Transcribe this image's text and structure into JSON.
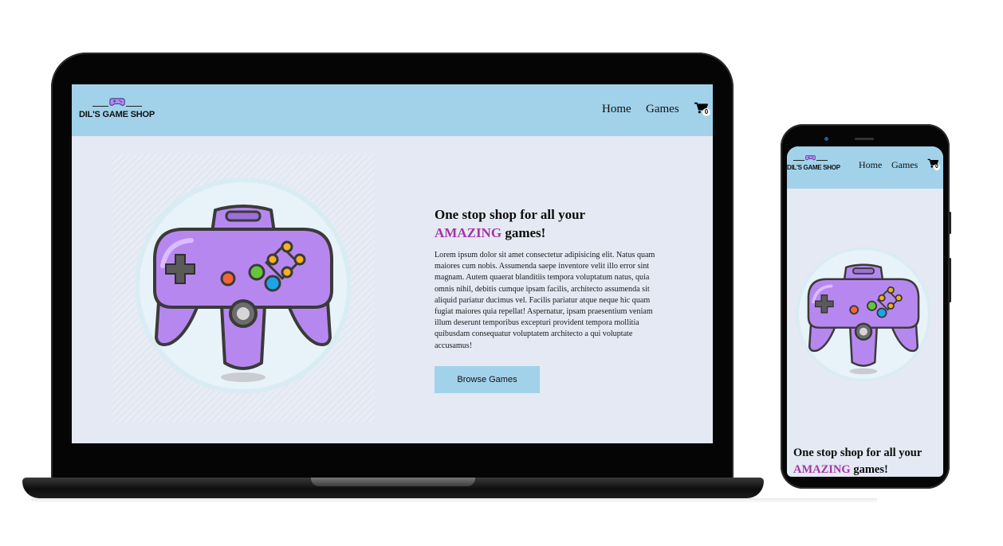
{
  "site": {
    "logo_text": "DIL'S GAME SHOP",
    "nav": {
      "home": "Home",
      "games": "Games"
    },
    "cart_count": "0"
  },
  "hero": {
    "title_prefix": "One stop shop for all your",
    "title_accent": "AMAZING",
    "title_suffix": "games!",
    "body": "Lorem ipsum dolor sit amet consectetur adipisicing elit. Natus quam maiores cum nobis. Assumenda saepe inventore velit illo error sint magnam. Autem quaerat blanditiis tempora voluptatum natus, quia omnis nihil, debitis cumque ipsam facilis, architecto assumenda sit aliquid pariatur ducimus vel. Facilis pariatur atque neque hic quam fugiat maiores quia repellat! Aspernatur, ipsam praesentium veniam illum deserunt temporibus excepturi provident tempora mollitia quibusdam consequatur voluptatem architecto a qui voluptate accusamus!",
    "button_label": "Browse Games"
  },
  "icons": {
    "logo": "gamepad-icon",
    "cart": "shopping-cart-icon",
    "hero_image": "game-controller-illustration"
  },
  "colors": {
    "header_bg": "#a1d2ea",
    "page_bg": "#e4e9f3",
    "accent": "#a335a7",
    "controller": "#b688ef",
    "button_bg": "#a1d2ea"
  }
}
